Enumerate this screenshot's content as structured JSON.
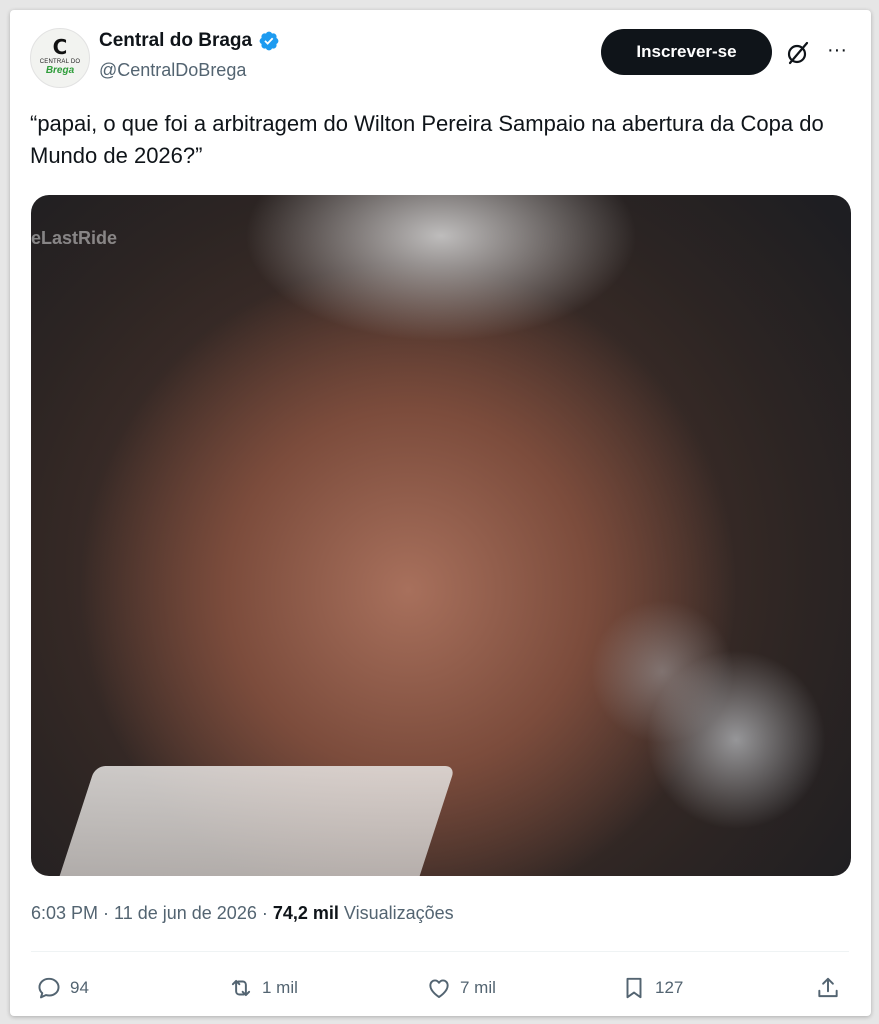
{
  "author": {
    "display_name": "Central do Braga",
    "handle": "@CentralDoBrega",
    "avatar_letter": "C",
    "avatar_line1": "CENTRAL DO",
    "avatar_line2": "Brega"
  },
  "header": {
    "subscribe_label": "Inscrever-se",
    "more_label": "···"
  },
  "tweet": {
    "text": "“papai, o que foi a arbitragem do Wilton Pereira Sampaio na abertura da Copa do Mundo de 2026?”",
    "media_watermark": "eLastRide"
  },
  "meta": {
    "time": "6:03 PM",
    "sep1": " · ",
    "date": "11 de jun de 2026",
    "sep2": " · ",
    "views_count": "74,2 mil",
    "views_label": " Visualizações"
  },
  "actions": {
    "replies": "94",
    "reposts": "1 mil",
    "likes": "7 mil",
    "bookmarks": "127"
  },
  "colors": {
    "verified": "#1d9bf0",
    "button_bg": "#0f1419",
    "secondary_text": "#536471"
  },
  "icons": [
    "verified-badge-icon",
    "grok-icon",
    "more-icon",
    "reply-icon",
    "repost-icon",
    "like-icon",
    "bookmark-icon",
    "share-icon"
  ]
}
